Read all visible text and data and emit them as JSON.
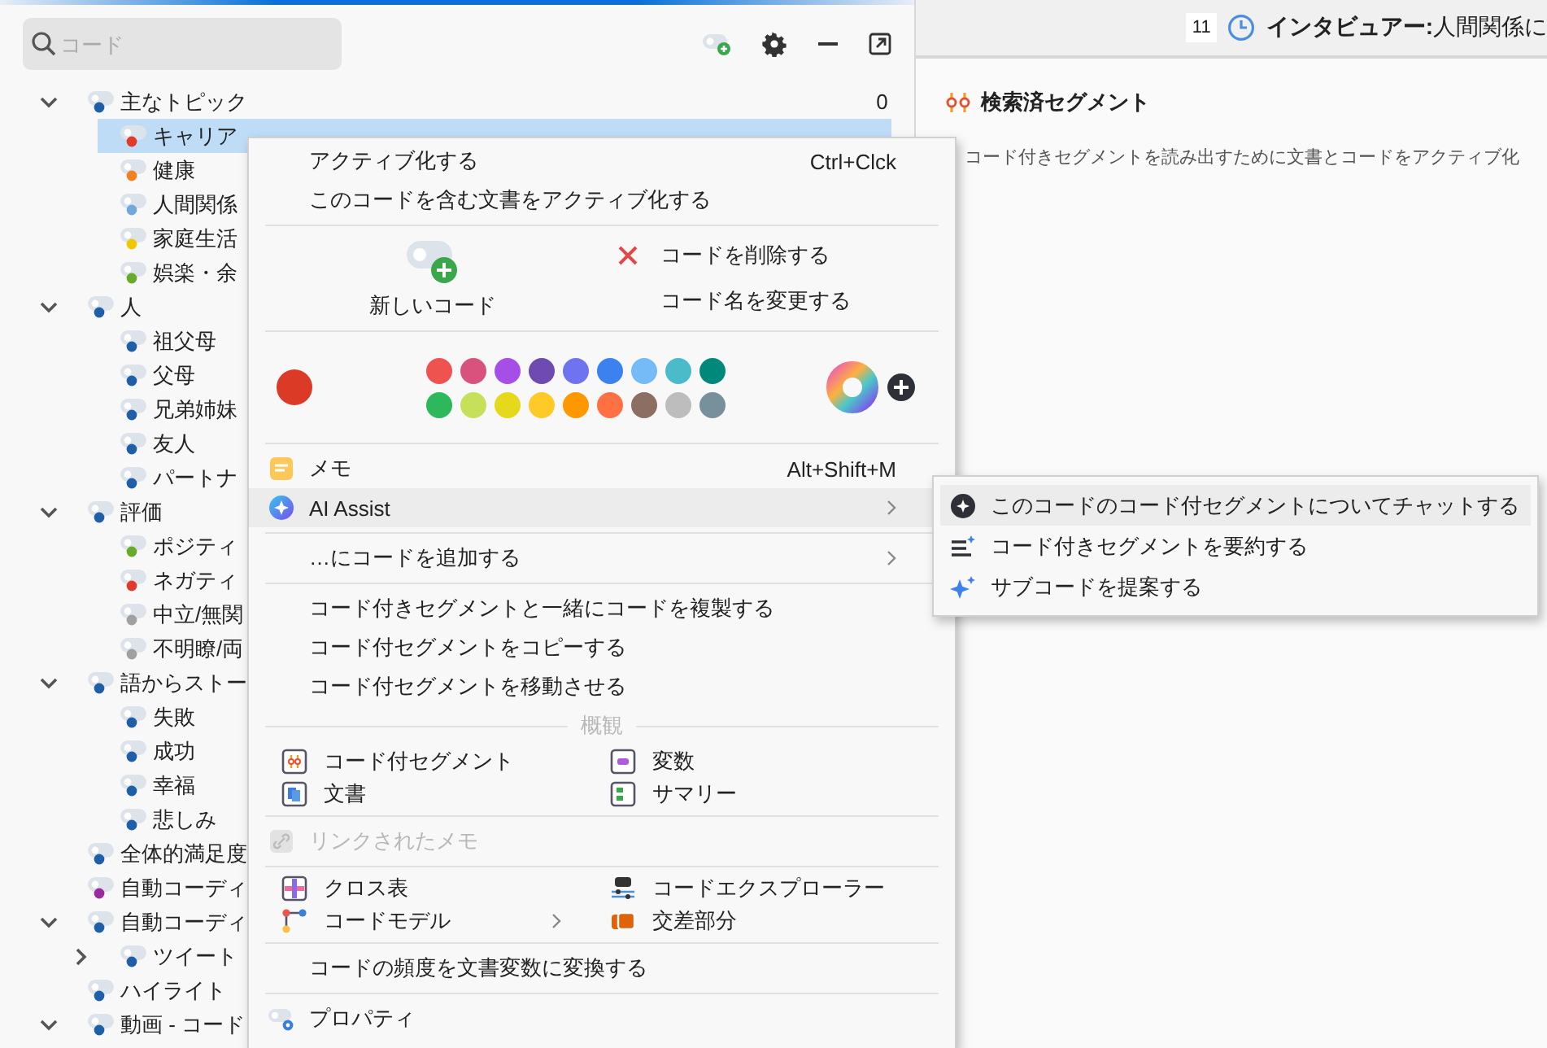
{
  "search": {
    "placeholder": "コード"
  },
  "tree": [
    {
      "label": "主なトピック",
      "color": "#1f5fa8",
      "count": "0",
      "selected": false,
      "expanded": true,
      "children": [
        {
          "label": "キャリア",
          "color": "#e03a2a",
          "selected": true
        },
        {
          "label": "健康",
          "color": "#f08020",
          "selected": false
        },
        {
          "label": "人間関係",
          "color": "#74a8dc",
          "selected": false
        },
        {
          "label": "家庭生活",
          "color": "#f0c800",
          "selected": false
        },
        {
          "label": "娯楽・余",
          "color": "#6aaa2a",
          "selected": false
        }
      ]
    },
    {
      "label": "人",
      "color": "#1f5fa8",
      "selected": false,
      "expanded": true,
      "children": [
        {
          "label": "祖父母",
          "color": "#1f5fa8",
          "selected": false
        },
        {
          "label": "父母",
          "color": "#1f5fa8",
          "selected": false
        },
        {
          "label": "兄弟姉妹",
          "color": "#1f5fa8",
          "selected": false
        },
        {
          "label": "友人",
          "color": "#1f5fa8",
          "selected": false
        },
        {
          "label": "パートナ",
          "color": "#1f5fa8",
          "selected": false
        }
      ]
    },
    {
      "label": "評価",
      "color": "#1f5fa8",
      "selected": false,
      "expanded": true,
      "children": [
        {
          "label": "ポジティ",
          "color": "#6aaa2a",
          "selected": false
        },
        {
          "label": "ネガティ",
          "color": "#e03a2a",
          "selected": false
        },
        {
          "label": "中立/無関",
          "color": "#a0a0a0",
          "selected": false
        },
        {
          "label": "不明瞭/両",
          "color": "#a0a0a0",
          "selected": false
        }
      ]
    },
    {
      "label": "語からストー",
      "color": "#1f5fa8",
      "selected": false,
      "expanded": true,
      "children": [
        {
          "label": "失敗",
          "color": "#1f5fa8",
          "selected": false
        },
        {
          "label": "成功",
          "color": "#1f5fa8",
          "selected": false
        },
        {
          "label": "幸福",
          "color": "#1f5fa8",
          "selected": false
        },
        {
          "label": "悲しみ",
          "color": "#1f5fa8",
          "selected": false
        }
      ]
    },
    {
      "label": "全体的満足度",
      "color": "#1f5fa8",
      "selected": false
    },
    {
      "label": "自動コーディ",
      "color": "#9b2aa0",
      "selected": false
    },
    {
      "label": "自動コーディ",
      "color": "#1f5fa8",
      "selected": false,
      "expanded": true,
      "children": [
        {
          "label": "ツイート",
          "color": "#1f5fa8",
          "selected": false,
          "expanded": false
        }
      ]
    },
    {
      "label": "ハイライト",
      "color": "#1f5fa8",
      "selected": false
    },
    {
      "label": "動画 - コード",
      "color": "#1f5fa8",
      "selected": false,
      "expanded": true
    }
  ],
  "document_bar": {
    "number": "11",
    "title": "**インタビュアー:**人間関係に"
  },
  "retrieved_segments": {
    "title": "検索済セグメント",
    "message": "コード付きセグメントを読み出すために文書とコードをアクティブ化"
  },
  "context_menu": {
    "items": [
      {
        "kind": "item",
        "label": "アクティブ化する",
        "shortcut": "Ctrl+Clck",
        "highlighted": false,
        "disabled": false,
        "has_submenu": false
      },
      {
        "kind": "item",
        "label": "このコードを含む文書をアクティブ化する",
        "highlighted": false,
        "disabled": false,
        "has_submenu": false
      },
      {
        "kind": "separator"
      },
      {
        "kind": "code_actions",
        "new_label": "新しいコード",
        "actions": [
          "コードを削除する",
          "コード名を変更する"
        ]
      },
      {
        "kind": "separator"
      },
      {
        "kind": "colors",
        "current": {
          "color": "#db3b26"
        },
        "palette": [
          {
            "color": "#ef5350"
          },
          {
            "color": "#d9527e"
          },
          {
            "color": "#a64ee8"
          },
          {
            "color": "#6f4ab0"
          },
          {
            "color": "#6f73f0"
          },
          {
            "color": "#3b82f0"
          },
          {
            "color": "#74bbf7"
          },
          {
            "color": "#4bbbc9"
          },
          {
            "color": "#00897b"
          },
          {
            "color": "#2eb85c"
          },
          {
            "color": "#c6e05a"
          },
          {
            "color": "#e6d81a"
          },
          {
            "color": "#ffca28"
          },
          {
            "color": "#ff9800"
          },
          {
            "color": "#ff7043"
          },
          {
            "color": "#8d6e63"
          },
          {
            "color": "#bdbdbd"
          },
          {
            "color": "#78909c"
          }
        ]
      },
      {
        "kind": "separator"
      },
      {
        "kind": "item",
        "label": "メモ",
        "shortcut": "Alt+Shift+M",
        "highlighted": false,
        "disabled": false,
        "has_submenu": false
      },
      {
        "kind": "item",
        "label": "AI Assist",
        "highlighted": true,
        "disabled": false,
        "has_submenu": true
      },
      {
        "kind": "separator"
      },
      {
        "kind": "item",
        "label": "…にコードを追加する",
        "highlighted": false,
        "disabled": false,
        "has_submenu": true
      },
      {
        "kind": "separator"
      },
      {
        "kind": "item",
        "label": "コード付きセグメントと一緒にコードを複製する",
        "highlighted": false,
        "disabled": false,
        "has_submenu": false
      },
      {
        "kind": "item",
        "label": "コード付セグメントをコピーする",
        "highlighted": false,
        "disabled": false,
        "has_submenu": false
      },
      {
        "kind": "item",
        "label": "コード付セグメントを移動させる",
        "highlighted": false,
        "disabled": false,
        "has_submenu": false
      },
      {
        "kind": "section",
        "label": "概観"
      },
      {
        "kind": "pair",
        "cells": [
          {
            "label": "コード付セグメント",
            "has_submenu": false
          },
          {
            "label": "変数",
            "has_submenu": false
          }
        ]
      },
      {
        "kind": "pair",
        "cells": [
          {
            "label": "文書",
            "has_submenu": false
          },
          {
            "label": "サマリー",
            "has_submenu": false
          }
        ]
      },
      {
        "kind": "separator"
      },
      {
        "kind": "item",
        "label": "リンクされたメモ",
        "highlighted": false,
        "disabled": true,
        "has_submenu": false
      },
      {
        "kind": "separator"
      },
      {
        "kind": "pair",
        "cells": [
          {
            "label": "クロス表",
            "has_submenu": false
          },
          {
            "label": "コードエクスプローラー",
            "has_submenu": false
          }
        ]
      },
      {
        "kind": "pair",
        "cells": [
          {
            "label": "コードモデル",
            "has_submenu": true
          },
          {
            "label": "交差部分",
            "has_submenu": false
          }
        ]
      },
      {
        "kind": "separator"
      },
      {
        "kind": "item",
        "label": "コードの頻度を文書変数に変換する",
        "highlighted": false,
        "disabled": false,
        "has_submenu": false
      },
      {
        "kind": "separator"
      },
      {
        "kind": "item",
        "label": "プロパティ",
        "highlighted": false,
        "disabled": false,
        "has_submenu": false
      }
    ]
  },
  "submenu": {
    "items": [
      {
        "label": "このコードのコード付セグメントについてチャットする",
        "selected": true
      },
      {
        "label": "コード付きセグメントを要約する",
        "selected": false
      },
      {
        "label": "サブコードを提案する",
        "selected": false
      }
    ]
  }
}
